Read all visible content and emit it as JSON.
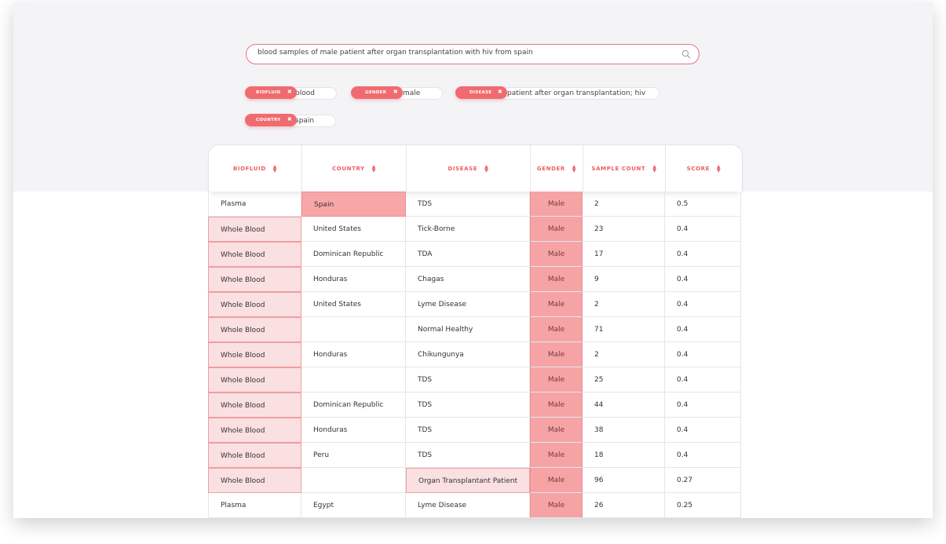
{
  "search": {
    "query": "blood samples of male patient after organ transplantation with hiv from spain"
  },
  "filters": [
    {
      "label": "BIOFLUID",
      "value": "blood"
    },
    {
      "label": "GENDER",
      "value": "male"
    },
    {
      "label": "DISEASE",
      "value": "patient after organ transplantation; hiv"
    },
    {
      "label": "COUNTRY",
      "value": "spain"
    }
  ],
  "remove_glyph": "✖",
  "table": {
    "columns": [
      "BIOFLUID",
      "COUNTRY",
      "DISEASE",
      "GENDER",
      "SAMPLE COUNT",
      "SCORE"
    ],
    "sort_up": "▲",
    "sort_down": "▼",
    "rows": [
      [
        "Plasma",
        "Spain",
        "TDS",
        "Male",
        "2",
        "0.5"
      ],
      [
        "Whole Blood",
        "United States",
        "Tick-Borne",
        "Male",
        "23",
        "0.4"
      ],
      [
        "Whole Blood",
        "Dominican Republic",
        "TDA",
        "Male",
        "17",
        "0.4"
      ],
      [
        "Whole Blood",
        "Honduras",
        "Chagas",
        "Male",
        "9",
        "0.4"
      ],
      [
        "Whole Blood",
        "United States",
        "Lyme Disease",
        "Male",
        "2",
        "0.4"
      ],
      [
        "Whole Blood",
        "",
        "Normal Healthy",
        "Male",
        "71",
        "0.4"
      ],
      [
        "Whole Blood",
        "Honduras",
        "Chikungunya",
        "Male",
        "2",
        "0.4"
      ],
      [
        "Whole Blood",
        "",
        "TDS",
        "Male",
        "25",
        "0.4"
      ],
      [
        "Whole Blood",
        "Dominican Republic",
        "TDS",
        "Male",
        "44",
        "0.4"
      ],
      [
        "Whole Blood",
        "Honduras",
        "TDS",
        "Male",
        "38",
        "0.4"
      ],
      [
        "Whole Blood",
        "Peru",
        "TDS",
        "Male",
        "18",
        "0.4"
      ],
      [
        "Whole Blood",
        "",
        "Organ Transplantant Patient",
        "Male",
        "96",
        "0.27"
      ],
      [
        "Plasma",
        "Egypt",
        "Lyme Disease",
        "Male",
        "26",
        "0.25"
      ]
    ]
  },
  "colors": {
    "accent": "#ef6b6f",
    "highlight_light": "#fbe0e1",
    "highlight_strong": "#f8a7a8"
  }
}
